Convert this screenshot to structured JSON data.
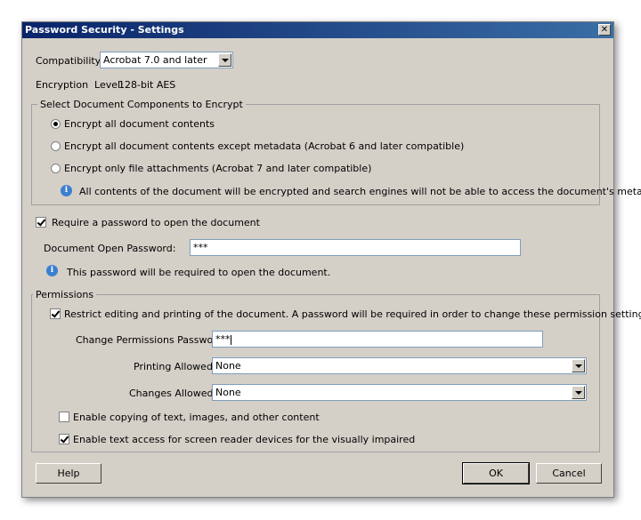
{
  "window": {
    "title": "Password Security - Settings",
    "close_glyph": "✕"
  },
  "compatibility": {
    "label": "Compatibility:",
    "value": "Acrobat 7.0 and later"
  },
  "encryption": {
    "label": "Encryption  Level:",
    "value": "128-bit AES"
  },
  "components": {
    "group_label": "Select Document Components to Encrypt",
    "options": [
      {
        "label": "Encrypt all document contents",
        "selected": true
      },
      {
        "label": "Encrypt all document contents except metadata (Acrobat 6 and later compatible)",
        "selected": false
      },
      {
        "label": "Encrypt only file attachments (Acrobat 7 and later compatible)",
        "selected": false
      }
    ],
    "info": "All contents of the document will be encrypted and search engines will not be able to access the document's metadata."
  },
  "open_password": {
    "checkbox_label": "Require a password to open the document",
    "checked": true,
    "field_label": "Document Open Password:",
    "value": "***",
    "info": "This password will be required to open the document."
  },
  "permissions": {
    "group_label": "Permissions",
    "restrict_label": "Restrict editing and printing of the document. A password will be required in order to change these permission settings.",
    "restrict_checked": true,
    "password_label": "Change Permissions Password:",
    "password_value": "***",
    "printing_label": "Printing Allowed:",
    "printing_value": "None",
    "changes_label": "Changes Allowed:",
    "changes_value": "None",
    "copy_label": "Enable copying of text, images, and other content",
    "copy_checked": false,
    "screenreader_label": "Enable text access for screen reader devices for the visually impaired",
    "screenreader_checked": true
  },
  "buttons": {
    "help": "Help",
    "ok": "OK",
    "cancel": "Cancel"
  },
  "icons": {
    "info": "info-icon"
  }
}
